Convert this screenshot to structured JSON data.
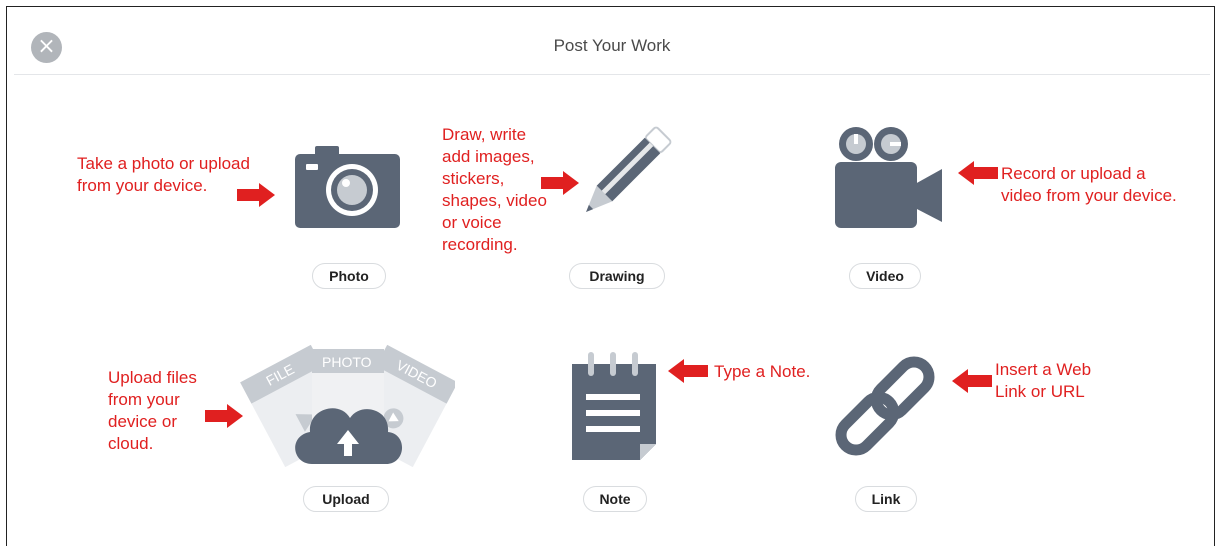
{
  "header": {
    "title": "Post Your Work",
    "close_icon": "×"
  },
  "tiles": {
    "photo": {
      "label": "Photo",
      "icon": "camera-icon"
    },
    "drawing": {
      "label": "Drawing",
      "icon": "pencil-icon"
    },
    "video": {
      "label": "Video",
      "icon": "video-camera-icon"
    },
    "upload": {
      "label": "Upload",
      "icon": "cloud-upload-icon",
      "card_labels": [
        "FILE",
        "PHOTO",
        "VIDEO"
      ]
    },
    "note": {
      "label": "Note",
      "icon": "notepad-icon"
    },
    "link": {
      "label": "Link",
      "icon": "link-icon"
    }
  },
  "annotations": {
    "photo": "Take a photo or upload\nfrom your device.",
    "drawing": "Draw, write\nadd images,\nstickers,\nshapes, video\nor voice\nrecording.",
    "video": "Record or upload a\nvideo from your device.",
    "upload": "Upload files\nfrom your\ndevice or\ncloud.",
    "note": "Type a Note.",
    "link": "Insert a Web\nLink or URL"
  },
  "colors": {
    "icon": "#5b6676",
    "annotation": "#e02020",
    "close_bg": "#b1b5ba"
  }
}
